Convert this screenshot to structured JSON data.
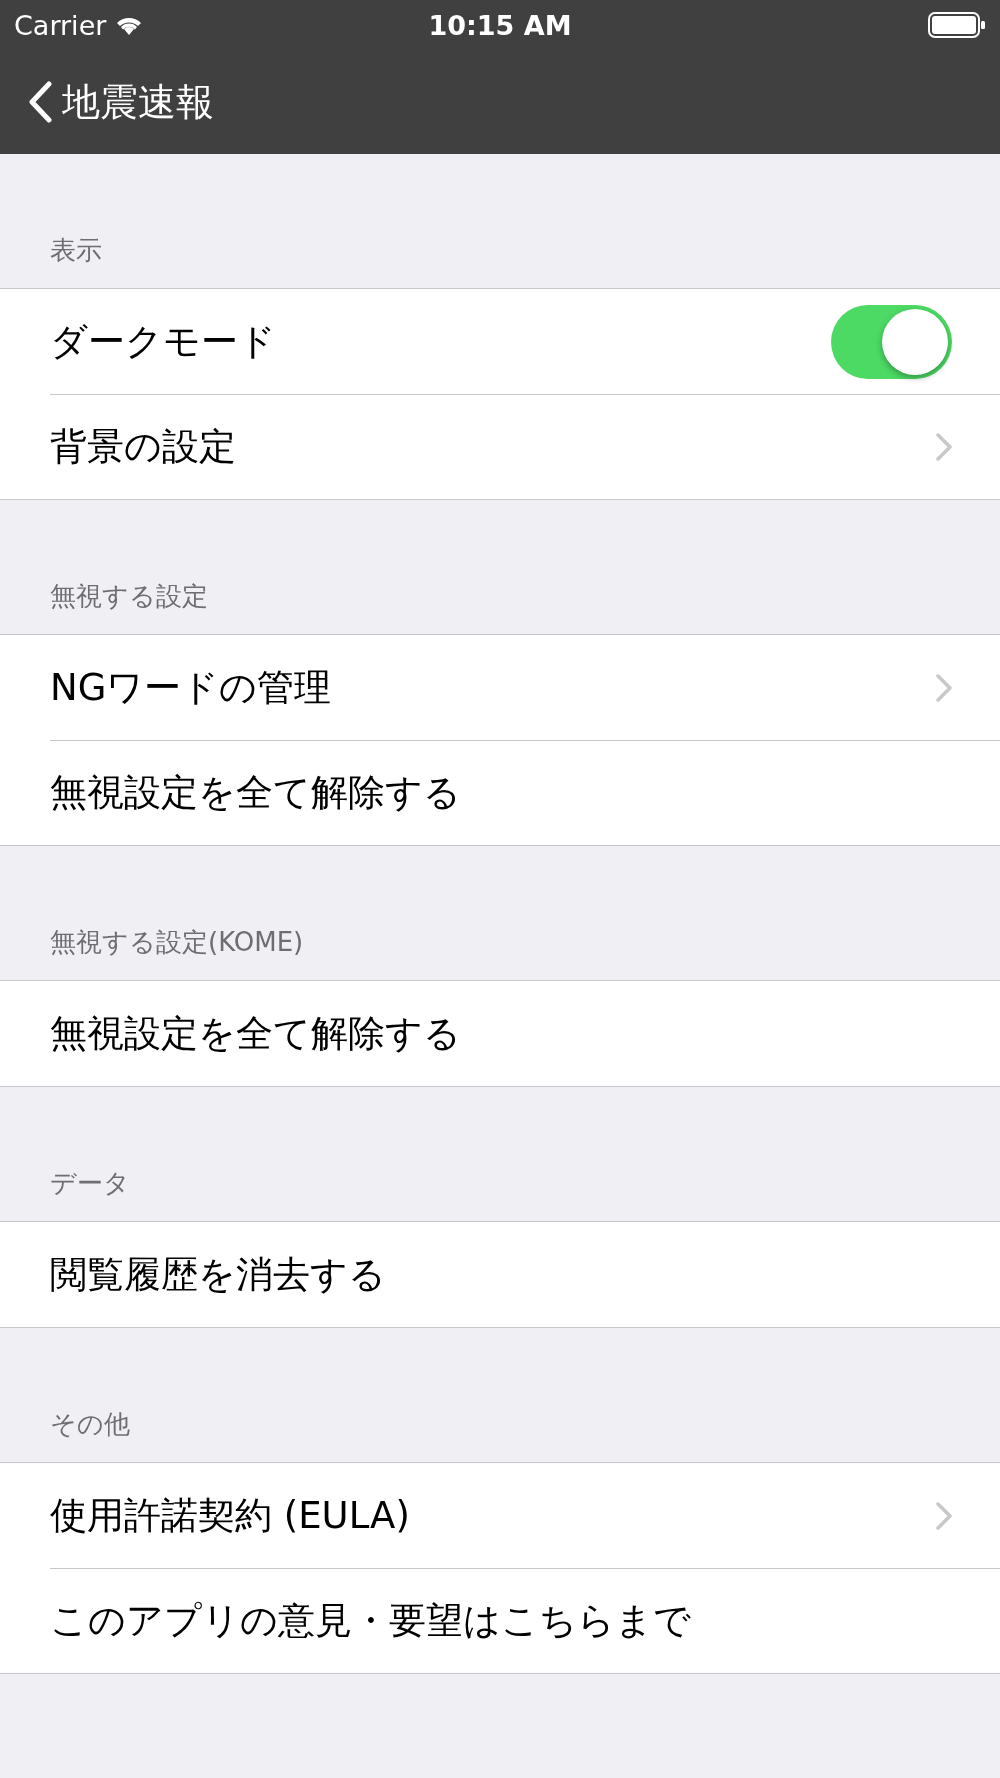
{
  "status_bar": {
    "carrier": "Carrier",
    "time": "10:15 AM"
  },
  "nav": {
    "back_title": "地震速報"
  },
  "sections": [
    {
      "header": "表示",
      "rows": [
        {
          "label": "ダークモード",
          "kind": "toggle",
          "on": true
        },
        {
          "label": "背景の設定",
          "kind": "disclosure"
        }
      ]
    },
    {
      "header": "無視する設定",
      "rows": [
        {
          "label": "NGワードの管理",
          "kind": "disclosure"
        },
        {
          "label": "無視設定を全て解除する",
          "kind": "action"
        }
      ]
    },
    {
      "header": "無視する設定(KOME)",
      "rows": [
        {
          "label": "無視設定を全て解除する",
          "kind": "action"
        }
      ]
    },
    {
      "header": "データ",
      "rows": [
        {
          "label": "閲覧履歴を消去する",
          "kind": "action"
        }
      ]
    },
    {
      "header": "その他",
      "rows": [
        {
          "label": "使用許諾契約 (EULA)",
          "kind": "disclosure"
        },
        {
          "label": "このアプリの意見・要望はこちらまで",
          "kind": "action"
        }
      ]
    }
  ]
}
